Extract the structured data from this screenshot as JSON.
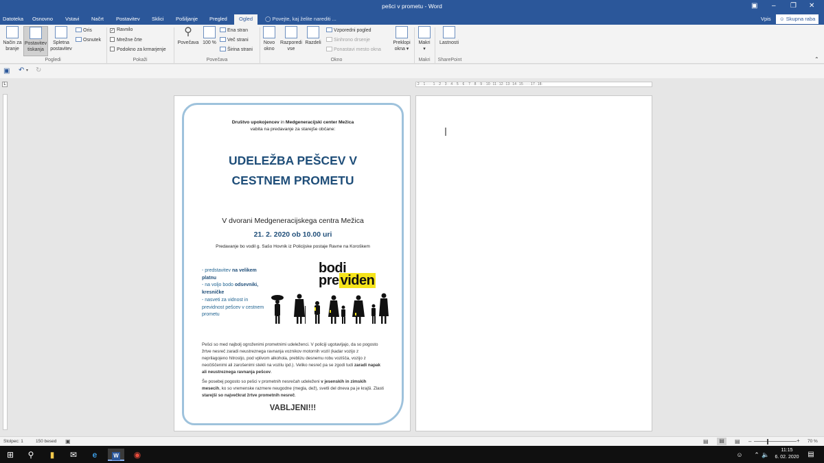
{
  "window": {
    "title": "pešci v prometu - Word",
    "controls": [
      "ribbon-display-icon",
      "minimize-icon",
      "restore-icon",
      "close-icon"
    ]
  },
  "tabs": [
    {
      "label": "Datoteka"
    },
    {
      "label": "Osnovno"
    },
    {
      "label": "Vstavi"
    },
    {
      "label": "Načrt"
    },
    {
      "label": "Postavitev"
    },
    {
      "label": "Sklici"
    },
    {
      "label": "Pošiljanje"
    },
    {
      "label": "Pregled"
    },
    {
      "label": "Ogled",
      "active": true
    }
  ],
  "tellme": "Povejte, kaj želite narediti ...",
  "account": {
    "signin": "Vpis",
    "share": "Skupna raba"
  },
  "ribbon": {
    "views": {
      "read": "Način za branje",
      "print": "Postavitev tiskanja",
      "web": "Spletna postavitev",
      "outline": "Oris",
      "draft": "Osnutek",
      "group": "Pogledi"
    },
    "show": {
      "ruler": "Ravnilo",
      "gridlines": "Mrežne črte",
      "navpane": "Podokno za krmarjenje",
      "group": "Pokaži",
      "ruler_checked": true
    },
    "zoom": {
      "zoom": "Povečava",
      "hundred": "100 %",
      "one": "Ena stran",
      "multi": "Več strani",
      "width": "Širina strani",
      "group": "Povečava"
    },
    "window": {
      "newwin": "Novo okno",
      "arrange": "Razporedi vse",
      "split": "Razdeli",
      "side": "Vzporedni pogled",
      "sync": "Sinhrono drsenje",
      "reset": "Ponastavi mesto okna",
      "switch": "Preklopi okna",
      "group": "Okno"
    },
    "macros": {
      "label": "Makri",
      "group": "Makri"
    },
    "sharepoint": {
      "label": "Lastnosti",
      "group": "SharePoint"
    }
  },
  "ruler": "·2···1······1···2···3···4···5···6···7···8···9···10··11··12··13··14··15······17··18·",
  "doc": {
    "org_line_b1": "Društvo upokojencev",
    "org_line_mid": " in ",
    "org_line_b2": "Medgeneracijski center Mežica",
    "invite": "vabita na predavanje za starejše občane:",
    "title1": "UDELEŽBA PEŠCEV V",
    "title2": "CESTNEM PROMETU",
    "venue": "V dvorani Medgeneracijskega centra Mežica",
    "datetime": "21. 2. 2020 ob 10.00 uri",
    "lecturer": "Predavanje bo vodil g. Sašo Hovnik iz Policijske postaje Ravne na Koroškem",
    "bullets": [
      {
        "pre": "- predstavitev ",
        "bold": "na velikem platnu",
        "post": ""
      },
      {
        "pre": "- na voljo bodo ",
        "bold": "odsevniki, kresničke",
        "post": ""
      },
      {
        "pre": "- nasveti za vidnost in previdnost pešcev v cestnem prometu",
        "bold": "",
        "post": ""
      }
    ],
    "logo_line1": "bodi",
    "logo_line2a": "pre",
    "logo_line2b": "viden",
    "para1_a": "Pešci so med najbolj ogroženimi prometnimi udeleženci. V policiji ugotavljajo, da so pogosto žrtve nesreč zaradi neustreznega ravnanja voznikov motornih vozil (kadar vozijo z neprilagojeno hitrostjo, pod vplivom alkohola, preblizu desnemu robu vozišča, vozijo z neočiščenimi ali zarošenimi stekli na vozilu ipd.). Veliko nesreč pa se zgodi tudi ",
    "para1_b": "zaradi napak ali neustreznega ravnanja pešcev",
    "para1_c": ".",
    "para2_a": "Še posebej pogosto so pešci v prometnih nesrečah udeleženi ",
    "para2_b": "v jesenskih in zimskih mesecih",
    "para2_c": ", ko so vremenske razmere neugodne (megla, dež), svetli del dneva pa je krajši. Zlasti ",
    "para2_d": "starejši so največkrat žrtve prometnih nesreč",
    "para2_e": ".",
    "closing": "VABLJENI!!!"
  },
  "status": {
    "column": "Stolpec: 1",
    "words": "150 besed",
    "zoom": "70 %"
  },
  "taskbar": {
    "time": "11:15",
    "date": "6. 02. 2020"
  },
  "colors": {
    "accent": "#2b579a",
    "title_blue": "#1f4e79",
    "frame": "#9ec2dc",
    "logo_yellow": "#f5e41a"
  }
}
